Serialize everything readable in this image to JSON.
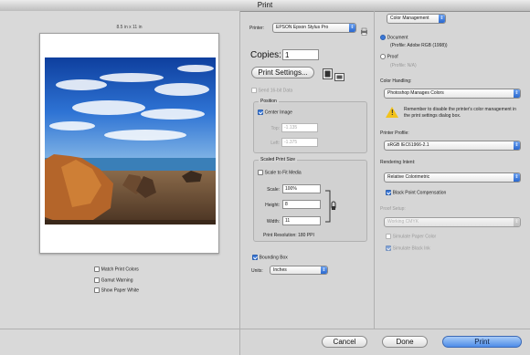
{
  "window": {
    "title": "Print"
  },
  "preview": {
    "paper_size": "8.5 in x 11 in"
  },
  "left_options": [
    {
      "label": "Match Print Colors",
      "checked": false
    },
    {
      "label": "Gamut Warning",
      "checked": false
    },
    {
      "label": "Show Paper White",
      "checked": false
    }
  ],
  "printer": {
    "label": "Printer:",
    "value": "EPSON Epson Stylus Pro"
  },
  "copies": {
    "label": "Copies:",
    "value": "1"
  },
  "print_settings_button": "Print Settings...",
  "send_16bit": {
    "label": "Send 16-bit Data",
    "checked": false
  },
  "position": {
    "title": "Position",
    "center_image": {
      "label": "Center Image",
      "checked": true
    },
    "top_label": "Top:",
    "top_value": "-1.135",
    "left_label": "Left:",
    "left_value": "-1.375"
  },
  "scaled": {
    "title": "Scaled Print Size",
    "scale_to_fit": {
      "label": "Scale to Fit Media",
      "checked": false
    },
    "scale_label": "Scale:",
    "scale_value": "100%",
    "height_label": "Height:",
    "height_value": "8",
    "width_label": "Width:",
    "width_value": "11",
    "resolution": "Print Resolution: 180 PPI"
  },
  "bounding_box": {
    "label": "Bounding Box",
    "checked": true
  },
  "units": {
    "label": "Units:",
    "value": "Inches"
  },
  "color_management": {
    "section_popup": "Color Management",
    "document": {
      "label": "Document",
      "profile": "(Profile: Adobe RGB (1998))",
      "selected": true
    },
    "proof": {
      "label": "Proof",
      "profile": "(Profile: N/A)",
      "selected": false
    },
    "color_handling_label": "Color Handling:",
    "color_handling_value": "Photoshop Manages Colors",
    "warning_text": "Remember to disable the printer's color management in the print settings dialog box.",
    "printer_profile_label": "Printer Profile:",
    "printer_profile_value": "sRGB IEC61966-2.1",
    "rendering_intent_label": "Rendering Intent:",
    "rendering_intent_value": "Relative Colorimetric",
    "black_point": {
      "label": "Black Point Compensation",
      "checked": true
    },
    "proof_setup_label": "Proof Setup:",
    "proof_setup_value": "Working CMYK",
    "simulate_paper": {
      "label": "Simulate Paper Color",
      "checked": false
    },
    "simulate_black": {
      "label": "Simulate Black Ink",
      "checked": true
    }
  },
  "buttons": {
    "cancel": "Cancel",
    "done": "Done",
    "print": "Print"
  }
}
